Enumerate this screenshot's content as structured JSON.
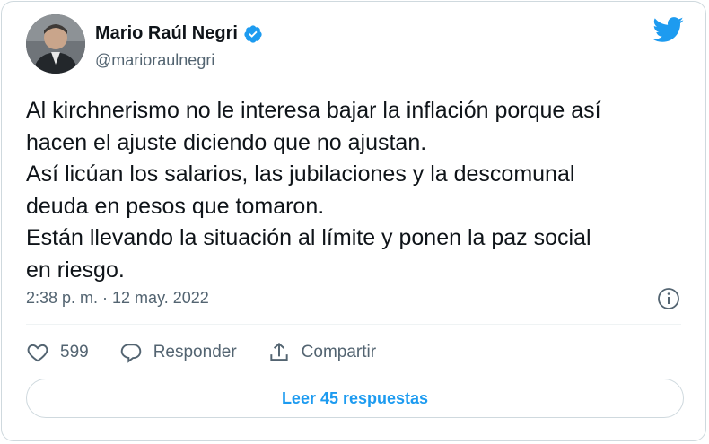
{
  "colors": {
    "brand": "#1d9bf0",
    "text": "#0f1419",
    "secondary_text": "#536471",
    "border": "#cfd9de"
  },
  "author": {
    "name": "Mario Raúl Negri",
    "handle": "@marioraulnegri",
    "verified_icon": "verified-badge-icon",
    "avatar": "profile-photo"
  },
  "brand_icon": "twitter-bird-icon",
  "tweet": {
    "text": "Al kirchnerismo no le interesa bajar la inflación porque así\nhacen el ajuste diciendo que no ajustan.\nAsí licúan los salarios, las jubilaciones y la descomunal\ndeuda en pesos que tomaron.\nEstán llevando la situación al límite y ponen la paz social\nen riesgo.",
    "timestamp": "2:38 p. m. · 12 may. 2022"
  },
  "info_icon": "info-icon",
  "actions": {
    "like": {
      "icon": "heart-icon",
      "label": "599"
    },
    "reply": {
      "icon": "reply-bubble-icon",
      "label": "Responder"
    },
    "share": {
      "icon": "share-upload-icon",
      "label": "Compartir"
    }
  },
  "read_replies_label": "Leer 45 respuestas"
}
